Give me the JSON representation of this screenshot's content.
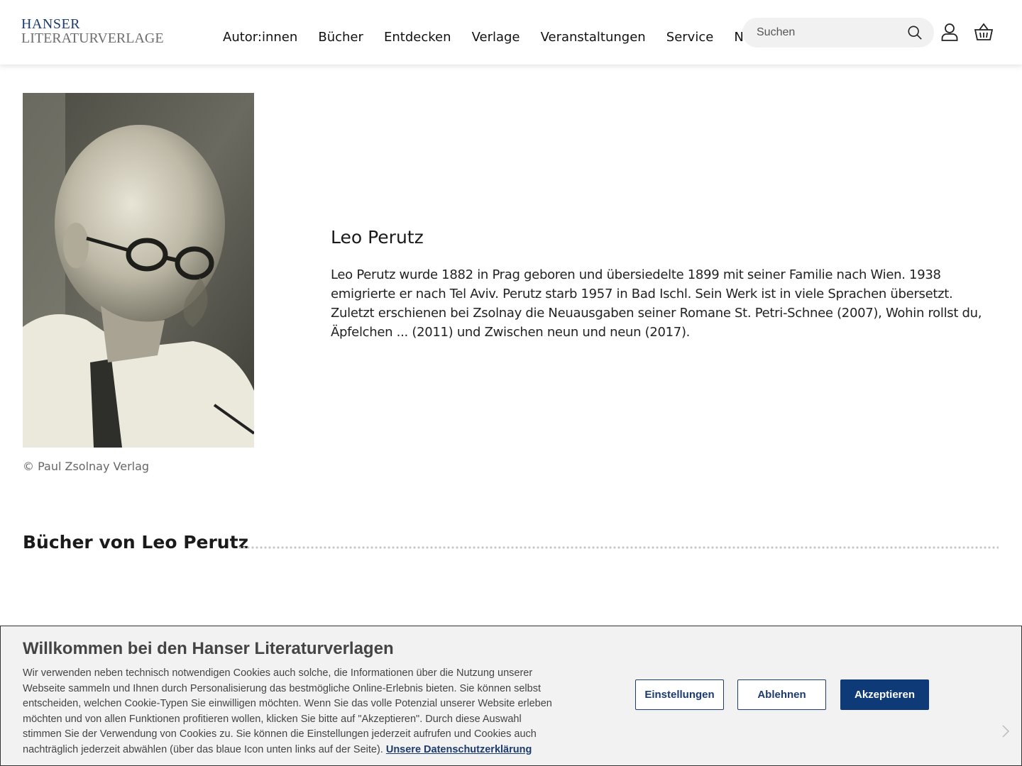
{
  "header": {
    "logo_line1": "HANSER",
    "logo_line2": "LITERATURVERLAGE",
    "nav": [
      "Autor:innen",
      "Bücher",
      "Entdecken",
      "Verlage",
      "Veranstaltungen",
      "Service",
      "Newsletter"
    ],
    "search_placeholder": "Suchen",
    "icons": {
      "search": "search-icon",
      "account": "user-icon",
      "cart": "basket-icon"
    }
  },
  "author": {
    "name": "Leo Perutz",
    "bio": "Leo Perutz wurde 1882 in Prag geboren und übersiedelte 1899 mit seiner Familie nach Wien. 1938 emigrierte er nach Tel Aviv. Perutz starb 1957 in Bad Ischl. Sein Werk ist in viele Sprachen übersetzt. Zuletzt erschienen bei Zsolnay die Neuausgaben seiner Romane St. Petri-Schnee (2007), Wohin rollst du, Äpfelchen ... (2011) und Zwischen neun und neun (2017).",
    "photo_caption": "© Paul Zsolnay Verlag"
  },
  "books_section": {
    "title": "Bücher von Leo Perutz"
  },
  "cookie_banner": {
    "title": "Willkommen bei den Hanser Literaturverlagen",
    "text": "Wir verwenden neben technisch notwendigen Cookies auch solche, die Informationen über die Nutzung unserer Webseite sammeln und Ihnen durch Personalisierung das bestmögliche Online-Erlebnis bieten. Sie können selbst entscheiden, welchen Cookie-Typen Sie einwilligen möchten. Wenn Sie das volle Potenzial unserer Website erleben möchten und von allen Funktionen profitieren wollen, klicken Sie bitte auf \"Akzeptieren\". Durch diese Auswahl stimmen Sie der Verwendung von Cookies zu. Sie können die Einstellungen jederzeit aufrufen und Cookies auch nachträglich jederzeit abwählen (über das blaue Icon unten links auf der Seite).",
    "privacy_link": "Unsere Datenschutzerklärung",
    "buttons": {
      "settings": "Einstellungen",
      "decline": "Ablehnen",
      "accept": "Akzeptieren"
    }
  },
  "colors": {
    "brand_blue": "#1c3b6e",
    "accept_button": "#0e3a78",
    "banner_bg": "#f2f2f2"
  }
}
